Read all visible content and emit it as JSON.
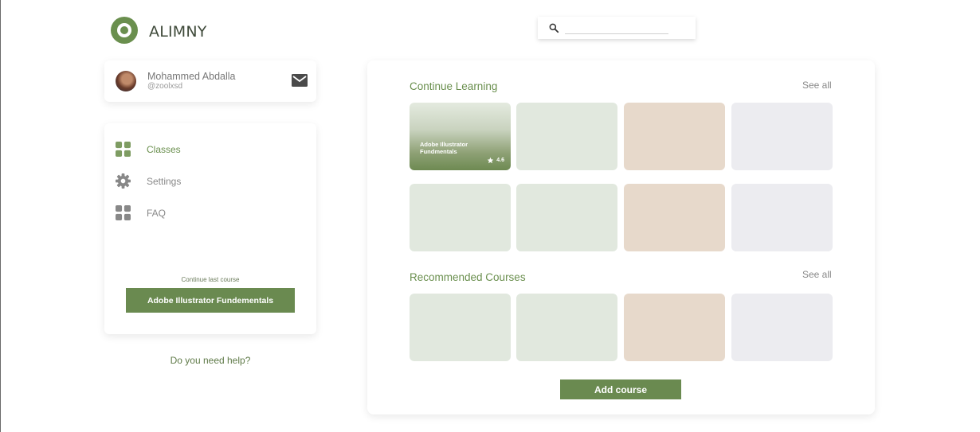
{
  "brand": {
    "name": "ALIMNY",
    "color": "#6a8f4e"
  },
  "search": {
    "placeholder": "",
    "value": "",
    "icon": "search-icon"
  },
  "profile": {
    "name": "Mohammed Abdalla",
    "handle": "@zoolxsd",
    "action_icon": "mail-icon"
  },
  "nav": {
    "items": [
      {
        "label": "Classes",
        "icon": "grid-icon",
        "active": true
      },
      {
        "label": "Settings",
        "icon": "gear-icon",
        "active": false
      },
      {
        "label": "FAQ",
        "icon": "grid-icon",
        "active": false
      }
    ],
    "continue_caption": "Continue last course",
    "continue_button": "Adobe Illustrator Fundementals"
  },
  "help_link": "Do you need help?",
  "main": {
    "continue_section": {
      "title": "Continue Learning",
      "see_all": "See all",
      "featured": {
        "title": "Adobe Illustrator Fundmentals",
        "rating": "4.6",
        "rating_icon": "star-icon"
      }
    },
    "recommended_section": {
      "title": "Recommended Courses",
      "see_all": "See all"
    },
    "add_button": "Add course"
  },
  "colors": {
    "accent": "#6a8a50",
    "tile_green": "#e1e8de",
    "tile_beige": "#e7d9cb",
    "tile_grey": "#ececf0"
  }
}
